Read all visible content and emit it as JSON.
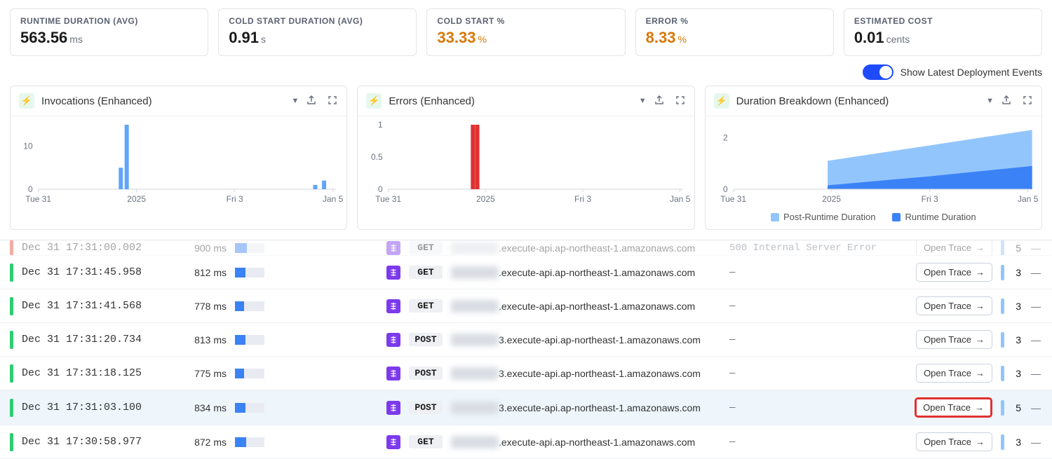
{
  "metrics": [
    {
      "label": "RUNTIME DURATION (AVG)",
      "value": "563.56",
      "unit": "ms",
      "orange": false
    },
    {
      "label": "COLD START DURATION (AVG)",
      "value": "0.91",
      "unit": "s",
      "orange": false
    },
    {
      "label": "COLD START %",
      "value": "33.33",
      "unit": "%",
      "orange": true
    },
    {
      "label": "ERROR %",
      "value": "8.33",
      "unit": "%",
      "orange": true
    },
    {
      "label": "ESTIMATED COST",
      "value": "0.01",
      "unit": "cents",
      "orange": false
    }
  ],
  "toggle": {
    "label": "Show Latest Deployment Events",
    "on": true
  },
  "charts": {
    "titles": [
      "Invocations (Enhanced)",
      "Errors (Enhanced)",
      "Duration Breakdown (Enhanced)"
    ],
    "x_ticks": [
      "Tue 31",
      "2025",
      "Fri 3",
      "Jan 5"
    ],
    "invocations_yticks": [
      "0",
      "10"
    ],
    "errors_yticks": [
      "0",
      "0.5",
      "1"
    ],
    "duration_yticks": [
      "0",
      "2"
    ],
    "legend": [
      "Post-Runtime Duration",
      "Runtime Duration"
    ],
    "legend_colors": [
      "#93c5fd",
      "#3b82f6"
    ]
  },
  "chart_data": [
    {
      "type": "bar",
      "title": "Invocations (Enhanced)",
      "categories": [
        "Tue 31",
        "2025",
        "Fri 3",
        "Jan 5"
      ],
      "x": [
        0.28,
        0.3,
        0.94,
        0.97
      ],
      "values": [
        5,
        15,
        1,
        2
      ],
      "ylim": [
        0,
        15
      ],
      "xlabel": "",
      "ylabel": ""
    },
    {
      "type": "bar",
      "title": "Errors (Enhanced)",
      "categories": [
        "Tue 31",
        "2025",
        "Fri 3",
        "Jan 5"
      ],
      "x": [
        0.29,
        0.305
      ],
      "values": [
        1,
        1
      ],
      "ylim": [
        0,
        1
      ],
      "color": "#e03131",
      "xlabel": "",
      "ylabel": ""
    },
    {
      "type": "area",
      "title": "Duration Breakdown (Enhanced)",
      "categories": [
        "Tue 31",
        "2025",
        "Fri 3",
        "Jan 5"
      ],
      "series": [
        {
          "name": "Post-Runtime Duration",
          "color": "#93c5fd",
          "values_at_xticks": [
            null,
            1.1,
            1.7,
            2.3
          ]
        },
        {
          "name": "Runtime Duration",
          "color": "#3b82f6",
          "values_at_xticks": [
            null,
            0.15,
            0.5,
            0.9
          ]
        }
      ],
      "start_x_frac": 0.32,
      "ylim": [
        0,
        2.5
      ],
      "xlabel": "",
      "ylabel": ""
    }
  ],
  "open_trace_label": "Open Trace",
  "rows": [
    {
      "status": "red",
      "cut": true,
      "ts": "Dec 31 17:31:00.002",
      "dur": "900 ms",
      "fill": 40,
      "method": "GET",
      "url": ".execute-api.ap-northeast-1.amazonaws.com",
      "status_text": "500 Internal Server Error",
      "spans": "5",
      "highlight": false,
      "boxed": false
    },
    {
      "status": "green",
      "cut": false,
      "ts": "Dec 31 17:31:45.958",
      "dur": "812 ms",
      "fill": 35,
      "method": "GET",
      "url": ".execute-api.ap-northeast-1.amazonaws.com",
      "status_text": "—",
      "spans": "3",
      "highlight": false,
      "boxed": false
    },
    {
      "status": "green",
      "cut": false,
      "ts": "Dec 31 17:31:41.568",
      "dur": "778 ms",
      "fill": 32,
      "method": "GET",
      "url": ".execute-api.ap-northeast-1.amazonaws.com",
      "status_text": "—",
      "spans": "3",
      "highlight": false,
      "boxed": false
    },
    {
      "status": "green",
      "cut": false,
      "ts": "Dec 31 17:31:20.734",
      "dur": "813 ms",
      "fill": 35,
      "method": "POST",
      "url": "3.execute-api.ap-northeast-1.amazonaws.com",
      "status_text": "—",
      "spans": "3",
      "highlight": false,
      "boxed": false
    },
    {
      "status": "green",
      "cut": false,
      "ts": "Dec 31 17:31:18.125",
      "dur": "775 ms",
      "fill": 32,
      "method": "POST",
      "url": "3.execute-api.ap-northeast-1.amazonaws.com",
      "status_text": "—",
      "spans": "3",
      "highlight": false,
      "boxed": false
    },
    {
      "status": "green",
      "cut": false,
      "ts": "Dec 31 17:31:03.100",
      "dur": "834 ms",
      "fill": 36,
      "method": "POST",
      "url": "3.execute-api.ap-northeast-1.amazonaws.com",
      "status_text": "—",
      "spans": "5",
      "highlight": true,
      "boxed": true
    },
    {
      "status": "green",
      "cut": false,
      "ts": "Dec 31 17:30:58.977",
      "dur": "872 ms",
      "fill": 38,
      "method": "GET",
      "url": ".execute-api.ap-northeast-1.amazonaws.com",
      "status_text": "—",
      "spans": "3",
      "highlight": false,
      "boxed": false
    }
  ]
}
